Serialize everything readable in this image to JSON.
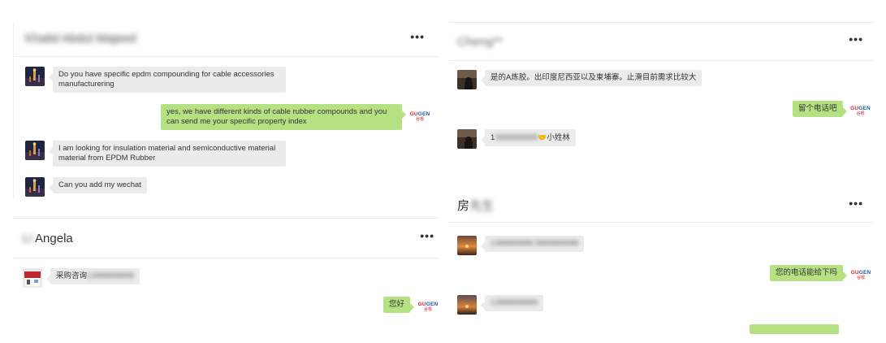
{
  "colors": {
    "incoming_bubble": "#ebebeb",
    "outgoing_bubble": "#b5e182",
    "divider": "#ececec"
  },
  "icons": {
    "more": "more-icon",
    "logo": "gugen-logo"
  },
  "logo": {
    "line1_a": "GU",
    "line1_b": "GEN",
    "line2": "谷根"
  },
  "more_label": "•••",
  "chats": [
    {
      "title": "Khalid Abdul Majeed",
      "messages": [
        {
          "dir": "in",
          "text": "Do you have specific epdm compounding for cable accessories manufacturering"
        },
        {
          "dir": "out",
          "text": "yes, we have different kinds of cable rubber compounds and you can send me your specific property index"
        },
        {
          "dir": "in",
          "text": "I am looking for insulation material and semiconductive material material from EPDM Rubber"
        },
        {
          "dir": "in",
          "text": "Can you add my wechat"
        }
      ]
    },
    {
      "title_prefix": "Li",
      "title": "Angela",
      "messages": [
        {
          "dir": "in",
          "text": "采购咨询",
          "masked": "13888888888"
        },
        {
          "dir": "out",
          "text": "您好"
        }
      ]
    },
    {
      "title": "Cheng**",
      "messages": [
        {
          "dir": "in",
          "text": "是的A炼胶。出印度尼西亚以及柬埔寨。止滑目前需求比较大"
        },
        {
          "dir": "out",
          "text": "留个电话吧"
        },
        {
          "dir": "in",
          "text_prefix": "1",
          "masked": "3888888888",
          "emoji": "🤝",
          "text": "小姓林"
        }
      ]
    },
    {
      "title": "房",
      "title_masked": "先生",
      "messages": [
        {
          "dir": "in",
          "masked": "1388888888 8888888888"
        },
        {
          "dir": "out",
          "text": "您的电话能给下吗"
        },
        {
          "dir": "in",
          "masked": "13888888888"
        }
      ]
    }
  ]
}
